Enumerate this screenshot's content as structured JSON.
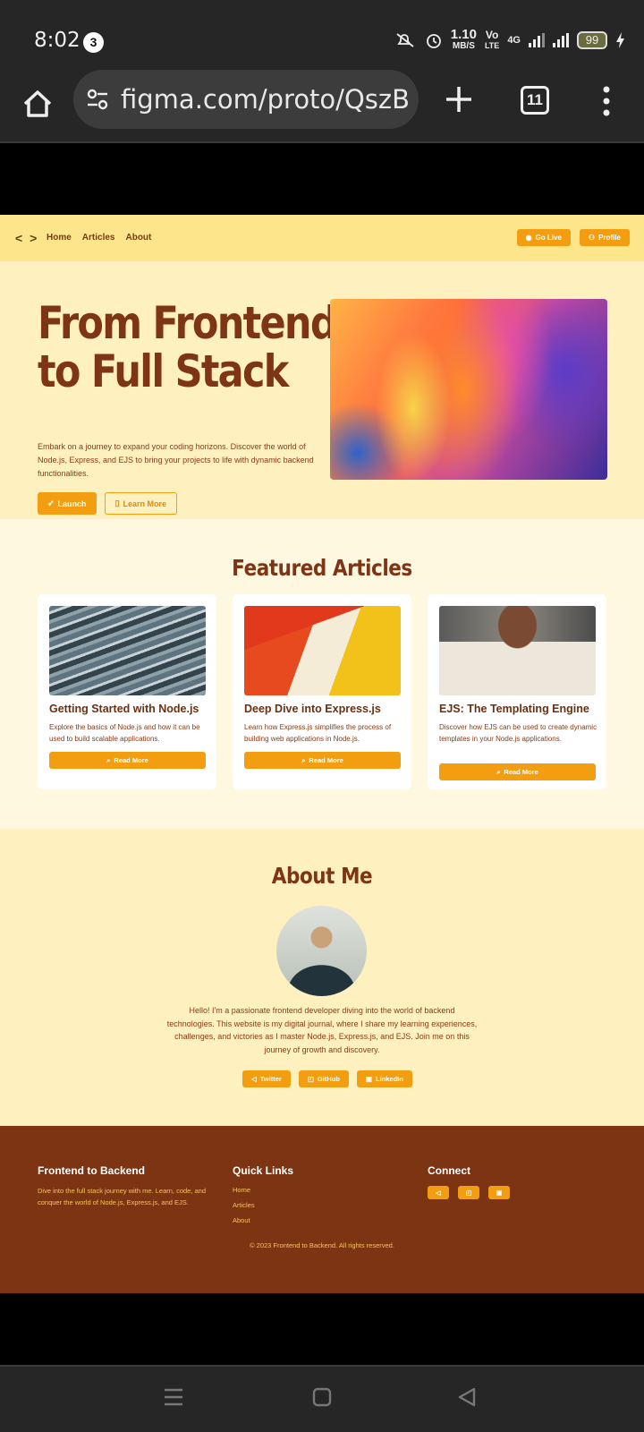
{
  "status": {
    "time": "8:02",
    "notif_count": "3",
    "speed_value": "1.10",
    "speed_unit": "MB/S",
    "vo": "Vo",
    "lte": "LTE",
    "net": "4G",
    "battery": "99"
  },
  "browser": {
    "url": "figma.com/proto/QszB",
    "tab_count": "11"
  },
  "site": {
    "nav": {
      "logo": "< >",
      "links": [
        "Home",
        "Articles",
        "About"
      ],
      "go_live": "Go Live",
      "profile": "Profile"
    },
    "hero": {
      "title_line1": "From Frontend",
      "title_line2": "to Full Stack",
      "desc": "Embark on a journey to expand your coding horizons. Discover the world of Node.js, Express, and EJS to bring your projects to life with dynamic backend functionalities.",
      "launch": "Launch",
      "learn": "Learn More"
    },
    "featured": {
      "heading": "Featured Articles",
      "cards": [
        {
          "title": "Getting Started with Node.js",
          "desc": "Explore the basics of Node.js and how it can be used to build scalable applications.",
          "button": "Read More"
        },
        {
          "title": "Deep Dive into Express.js",
          "desc": "Learn how Express.js simplifies the process of building web applications in Node.js.",
          "button": "Read More"
        },
        {
          "title": "EJS: The Templating Engine",
          "desc": "Discover how EJS can be used to create dynamic templates in your Node.js applications.",
          "button": "Read More"
        }
      ]
    },
    "about": {
      "heading": "About Me",
      "bio": "Hello! I'm a passionate frontend developer diving into the world of backend technologies. This website is my digital journal, where I share my learning experiences, challenges, and victories as I master Node.js, Express.js, and EJS. Join me on this journey of growth and discovery.",
      "social": [
        "Twitter",
        "GitHub",
        "LinkedIn"
      ]
    },
    "footer": {
      "brand_title": "Frontend to Backend",
      "brand_desc": "Dive into the full stack journey with me. Learn, code, and conquer the world of Node.js, Express.js, and EJS.",
      "links_title": "Quick Links",
      "links": [
        "Home",
        "Articles",
        "About"
      ],
      "connect_title": "Connect",
      "copyright": "© 2023 Frontend to Backend. All rights reserved."
    }
  },
  "colors": {
    "accent": "#f39e10",
    "brand_brown": "#7d3412",
    "nav_bg": "#fde58c",
    "hero_bg": "#fff1bf"
  }
}
